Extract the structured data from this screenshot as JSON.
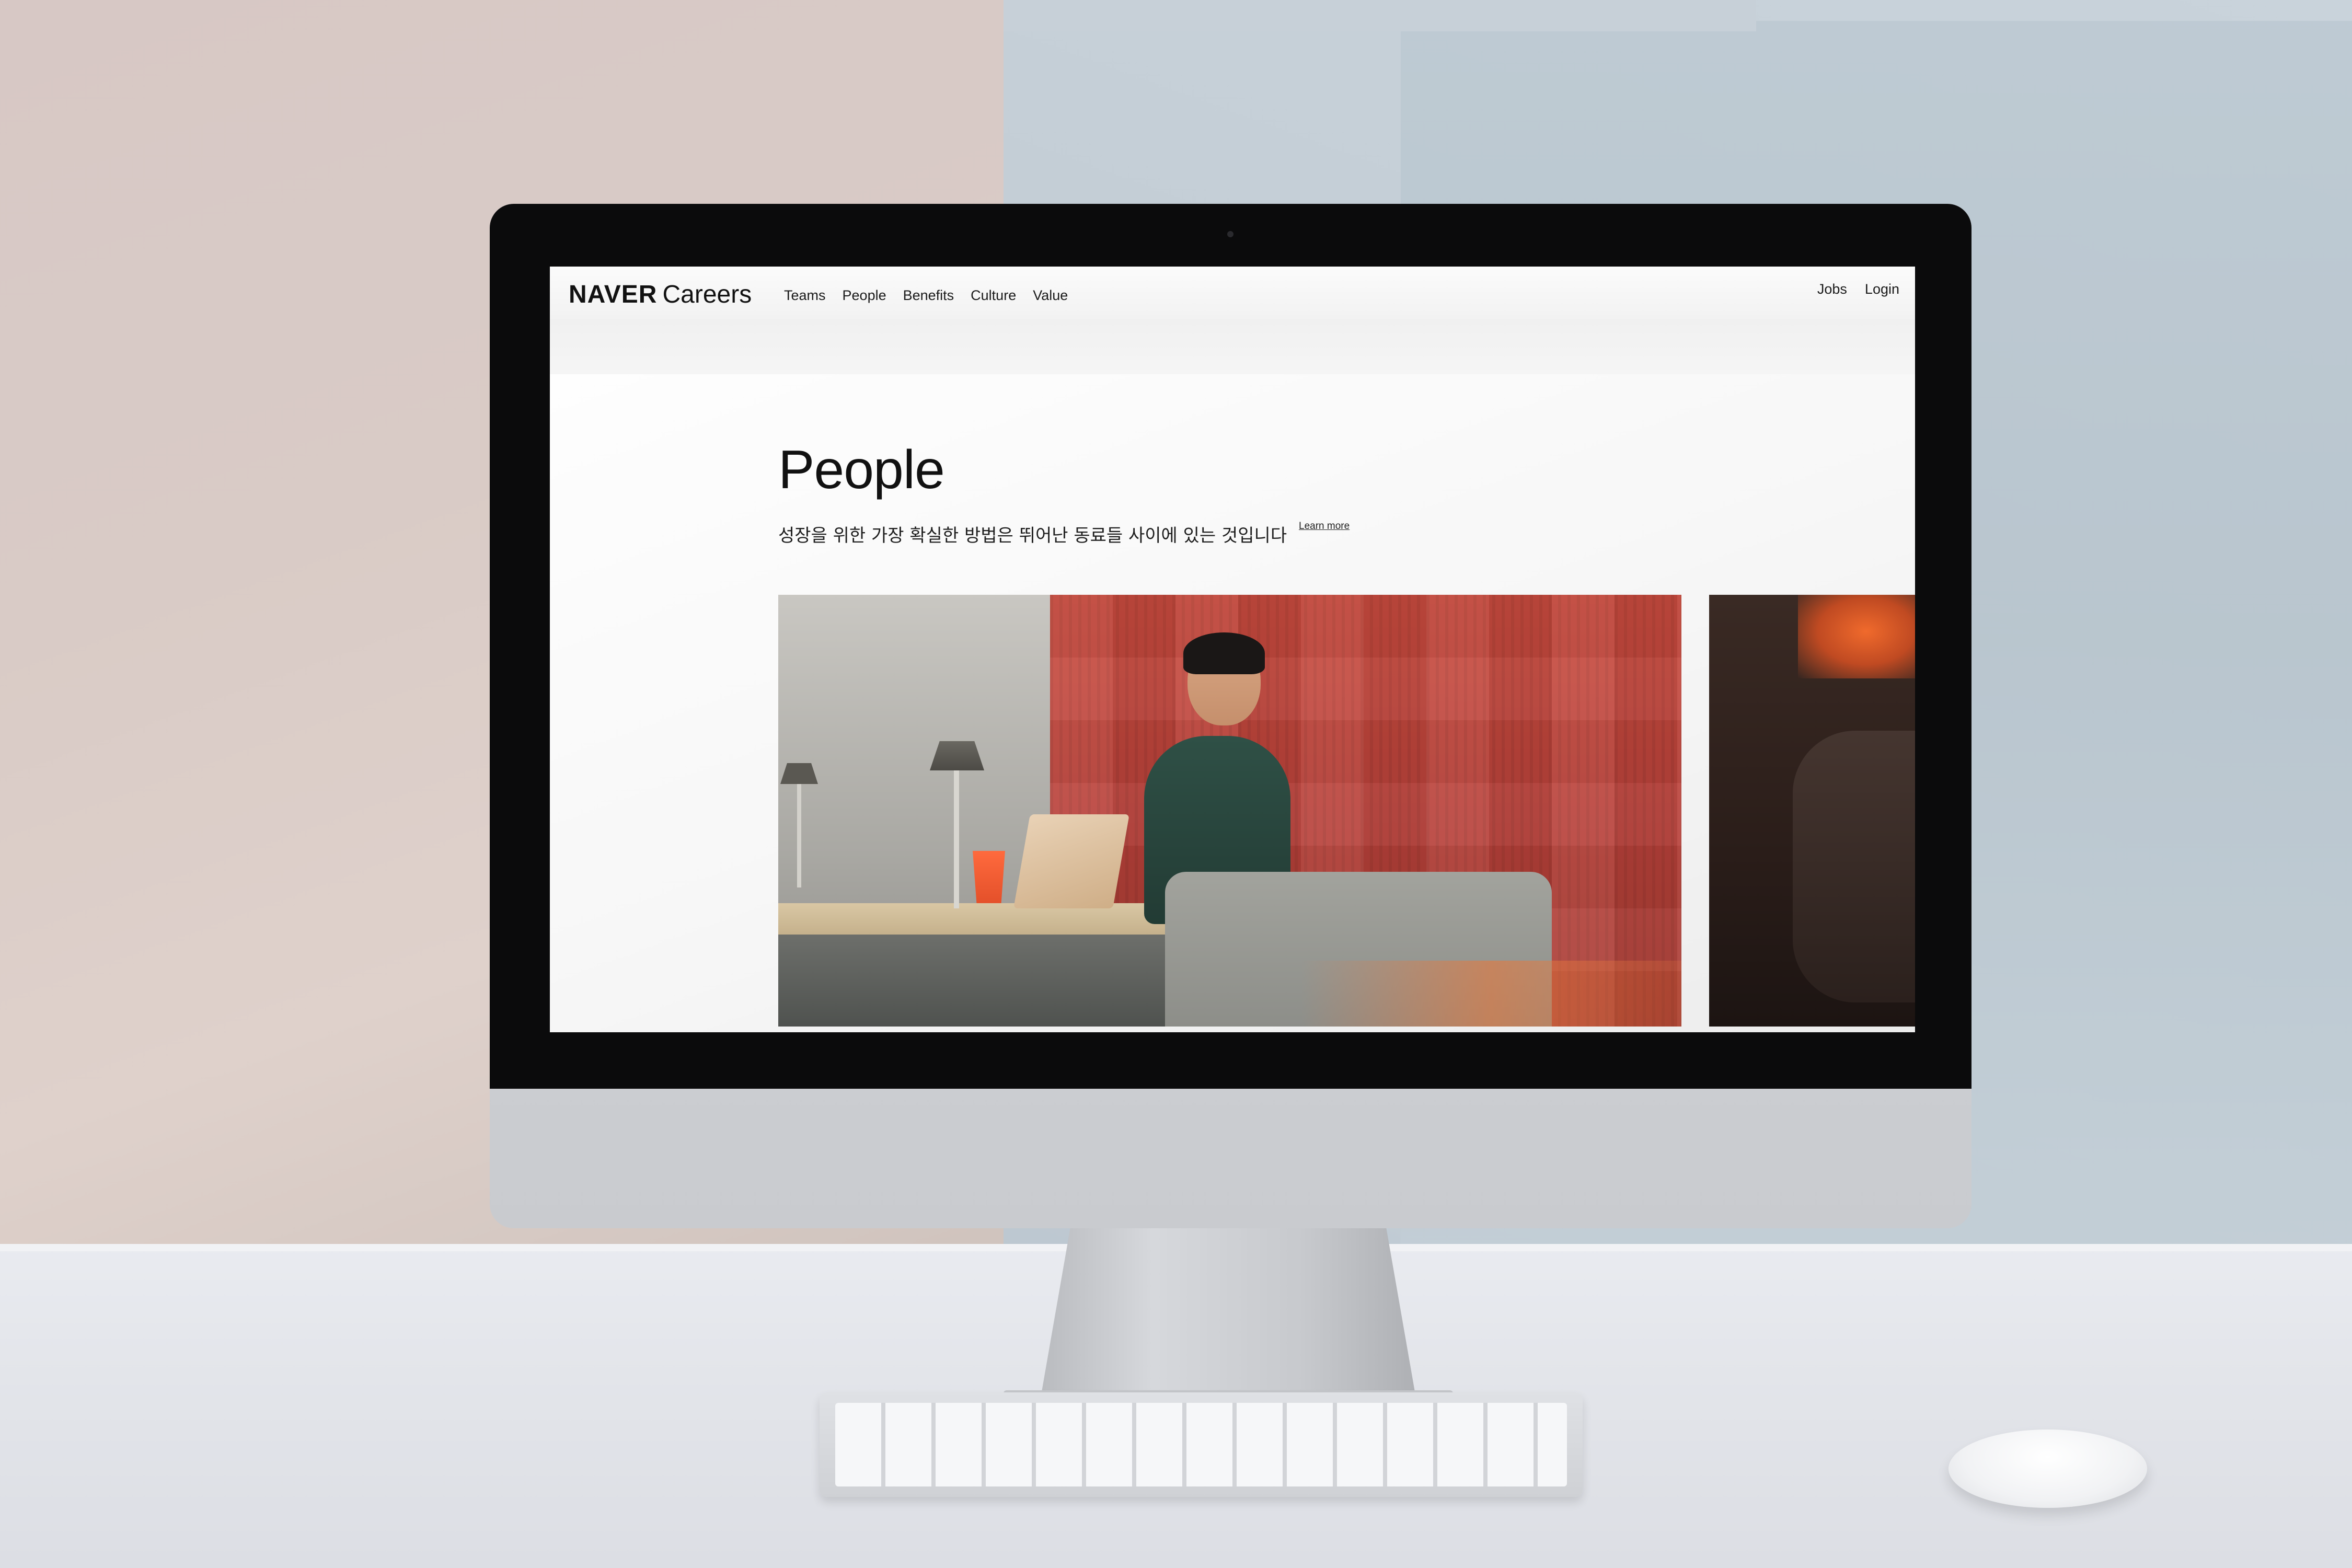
{
  "site": {
    "brand": "NAVER",
    "brand_suffix": "Careers"
  },
  "nav": {
    "links": [
      "Teams",
      "People",
      "Benefits",
      "Culture",
      "Value"
    ],
    "right_links": [
      "Jobs",
      "Login"
    ]
  },
  "hero": {
    "title": "People",
    "subtitle": "성장을 위한 가장 확실한 방법은 뛰어난 동료들 사이에 있는 것입니다",
    "learn_more": "Learn more"
  },
  "colors": {
    "accent_red_wall": "#b9423a",
    "accent_cup": "#ff6a3d",
    "text": "#111111"
  }
}
